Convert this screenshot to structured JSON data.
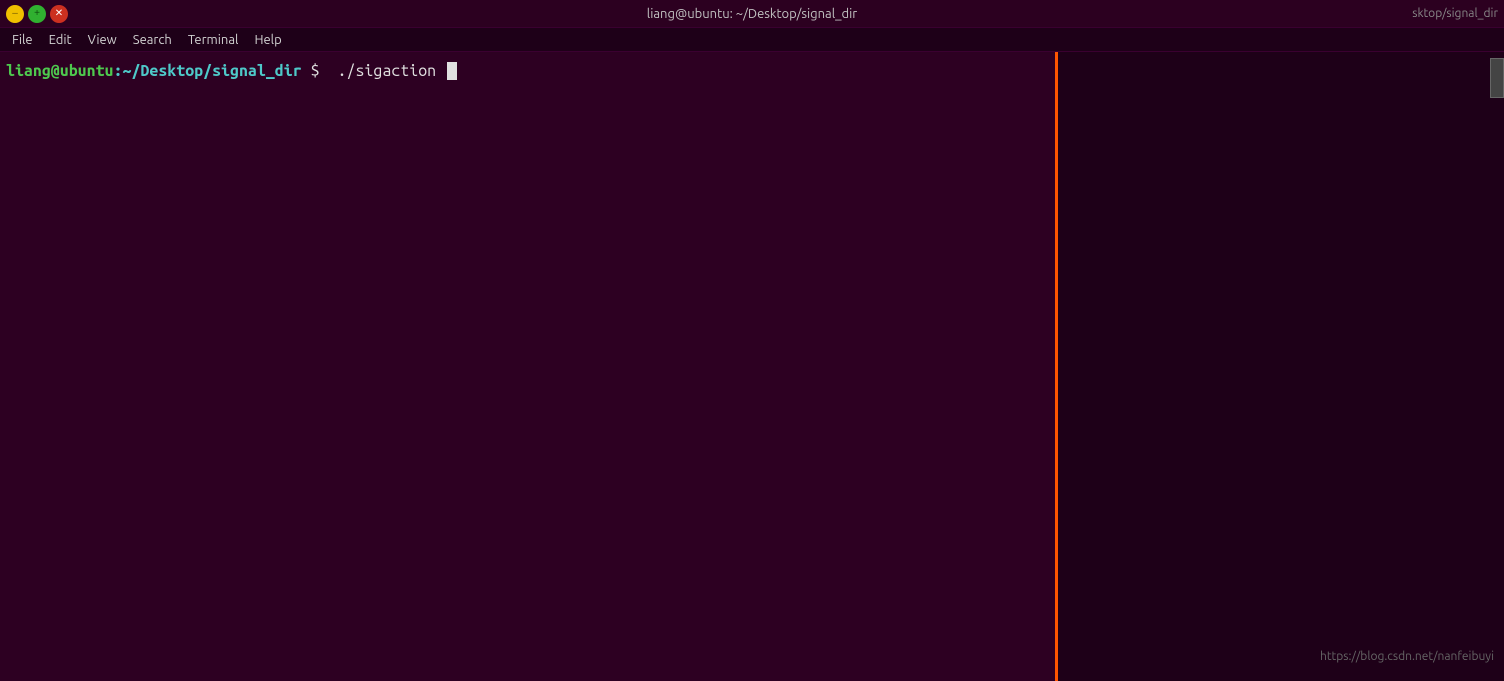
{
  "titlebar": {
    "title": "liang@ubuntu: ~/Desktop/signal_dir",
    "right_title": "sktop/signal_dir"
  },
  "menubar": {
    "items": [
      "File",
      "Edit",
      "View",
      "Search",
      "Terminal",
      "Help"
    ]
  },
  "terminal": {
    "prompt_user": "liang@ubuntu",
    "prompt_path": ":~/Desktop/signal_dir",
    "prompt_dollar": "$",
    "command": " ./sigaction "
  },
  "watermark": {
    "text": "https://blog.csdn.net/nanfeibuyi"
  }
}
